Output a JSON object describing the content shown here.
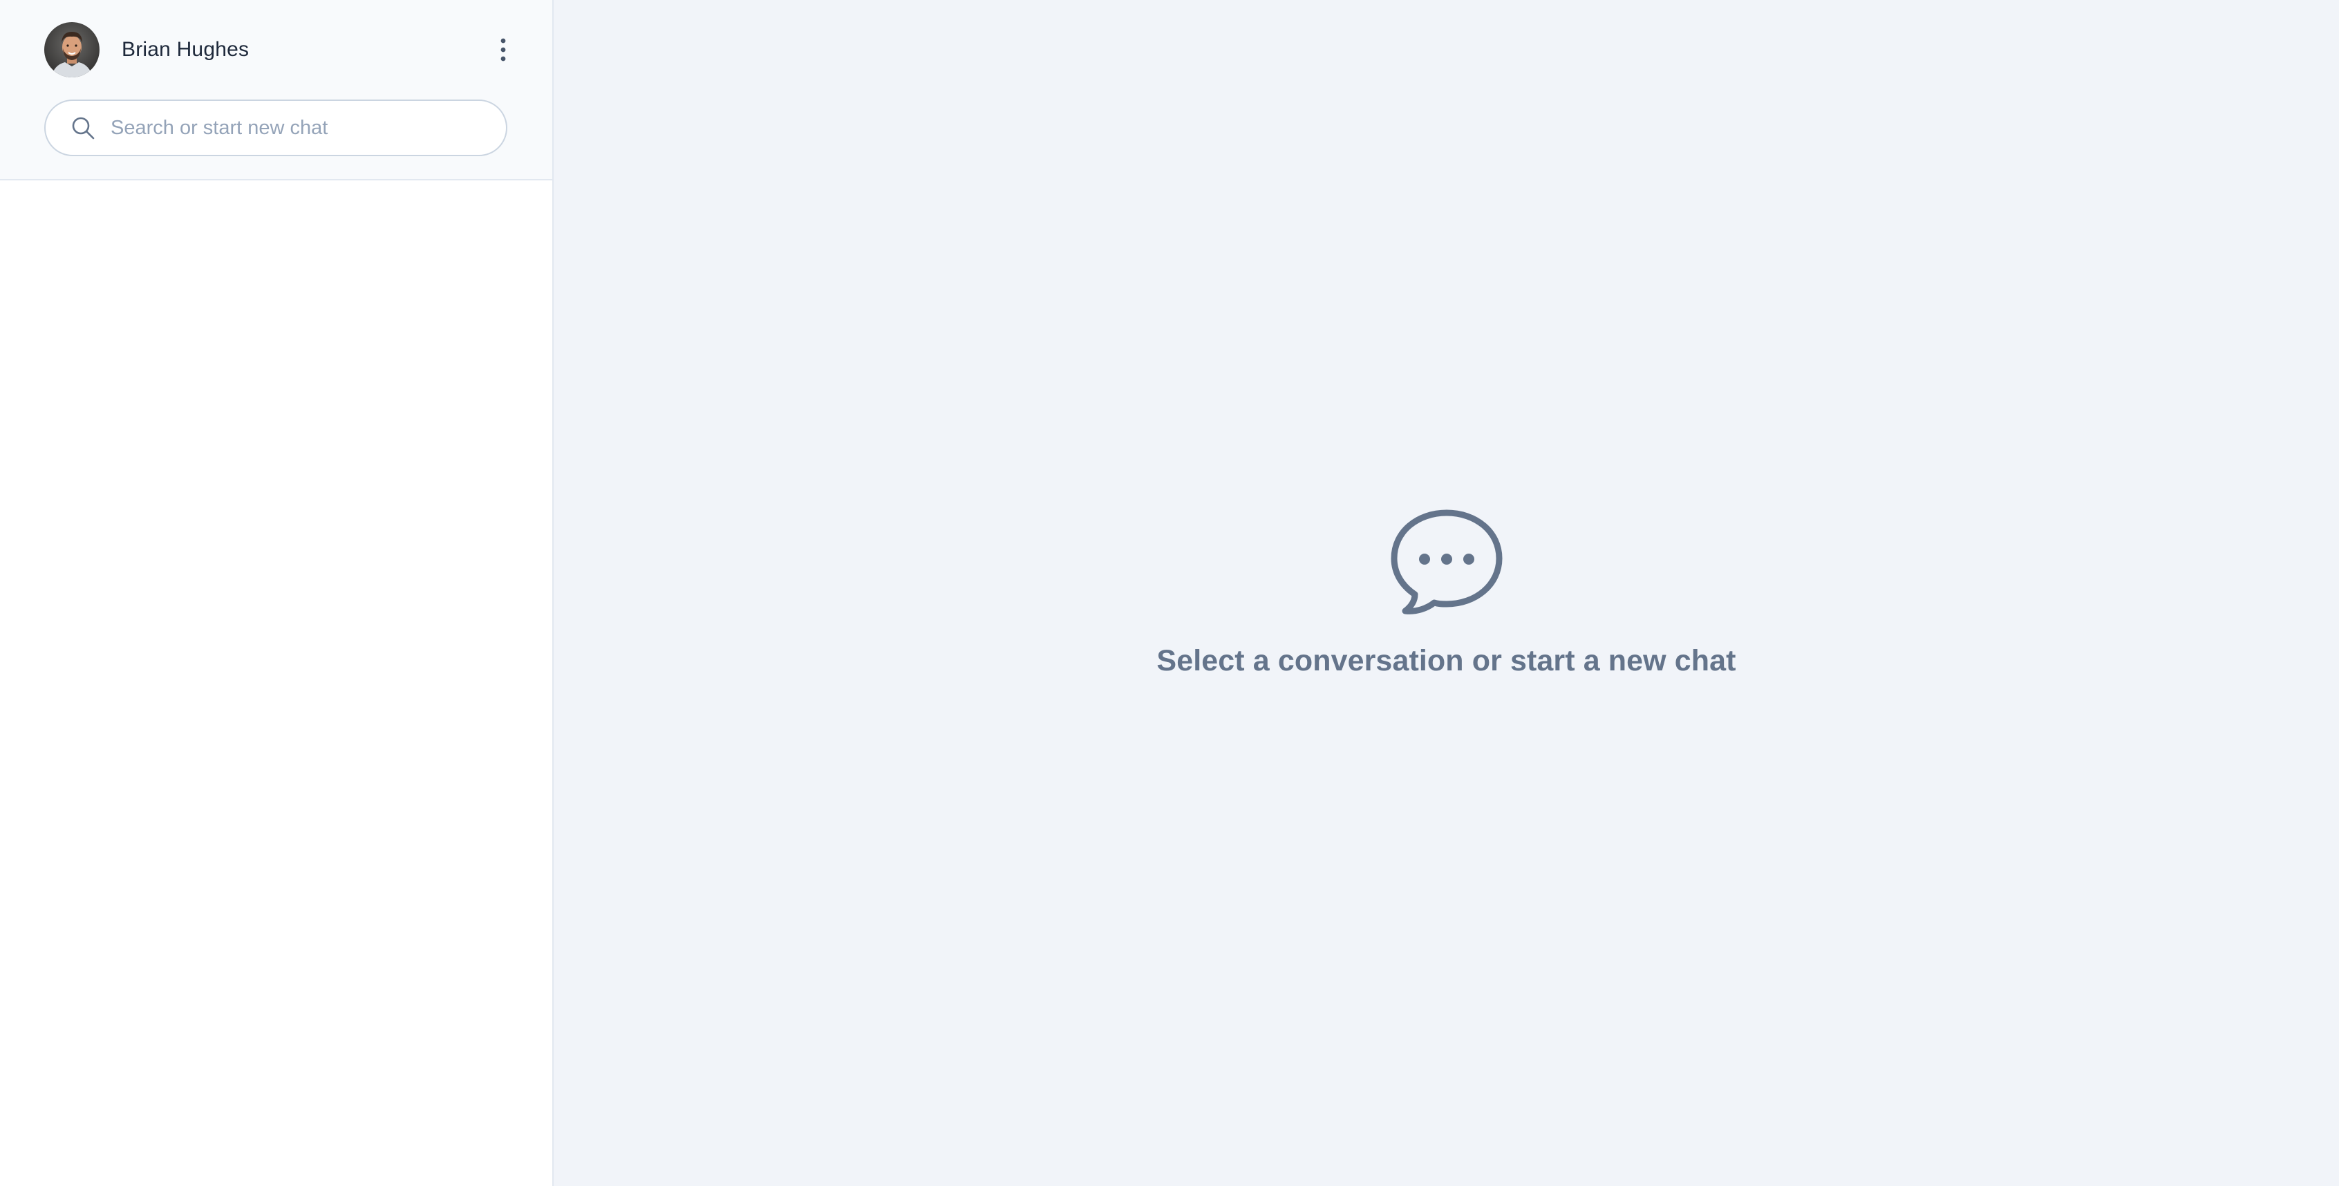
{
  "user": {
    "name": "Brian Hughes",
    "avatar_alt": "user-avatar"
  },
  "search": {
    "placeholder": "Search or start new chat",
    "value": ""
  },
  "main": {
    "empty_message": "Select a conversation or start a new chat"
  },
  "icons": {
    "search": "search-icon",
    "menu": "more-vertical-icon",
    "empty": "chat-bubble-icon"
  },
  "colors": {
    "sidebar_bg": "#ffffff",
    "sidebar_header_bg": "#f8fafc",
    "main_bg": "#f1f4f9",
    "border": "#e2e8f0",
    "muted_text": "#64748b",
    "placeholder_text": "#94a3b8",
    "primary_text": "#1e293b"
  }
}
